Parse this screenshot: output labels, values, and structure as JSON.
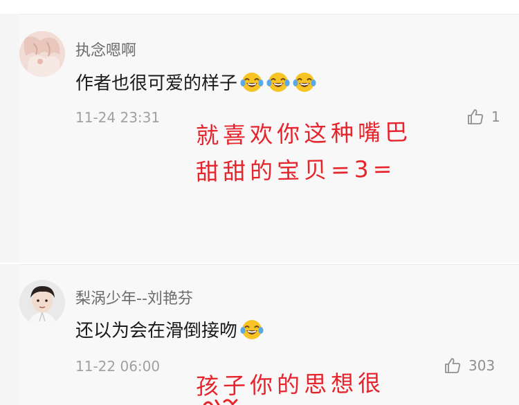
{
  "comments": [
    {
      "username": "执念嗯啊",
      "text": "作者也很可爱的样子",
      "emoji_count": 3,
      "emoji": "laughing-tears-emoji",
      "timestamp": "11-24 23:31",
      "likes": "1",
      "annotation_lines": [
        "就喜欢你这种嘴巴",
        "甜甜的宝贝=3="
      ]
    },
    {
      "username": "梨涡少年--刘艳芬",
      "text": "还以为会在滑倒接吻",
      "emoji_count": 1,
      "emoji": "laughing-tears-emoji",
      "timestamp": "11-22 06:00",
      "likes": "303",
      "annotation_lines": [
        "孩子你的思想很"
      ]
    }
  ],
  "colors": {
    "annotation": "#e5242b",
    "username": "#6b6b6b",
    "timestamp": "#a0a0a4",
    "background": "#f8f8f9"
  },
  "icons": [
    "thumbs-up-icon",
    "laughing-tears-emoji"
  ]
}
